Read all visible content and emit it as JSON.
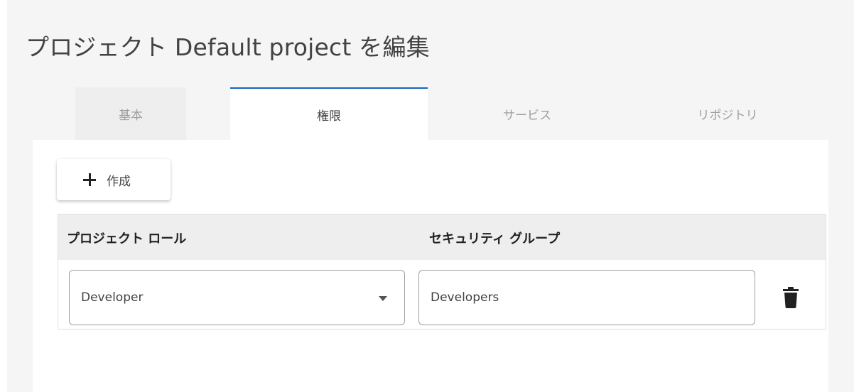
{
  "title": "プロジェクト Default project を編集",
  "tabs": [
    {
      "label": "基本",
      "active": false
    },
    {
      "label": "権限",
      "active": true
    },
    {
      "label": "サービス",
      "active": false
    },
    {
      "label": "リポジトリ",
      "active": false
    }
  ],
  "create_button": {
    "label": "作成",
    "icon": "plus-icon"
  },
  "table": {
    "headers": {
      "role": "プロジェクト ロール",
      "group": "セキュリティ グループ"
    },
    "rows": [
      {
        "role": "Developer",
        "group": "Developers",
        "delete_icon": "trash-icon"
      }
    ]
  },
  "colors": {
    "accent": "#1565c0",
    "background": "#f5f5f5",
    "panel": "#ffffff",
    "header": "#eeeeee"
  }
}
